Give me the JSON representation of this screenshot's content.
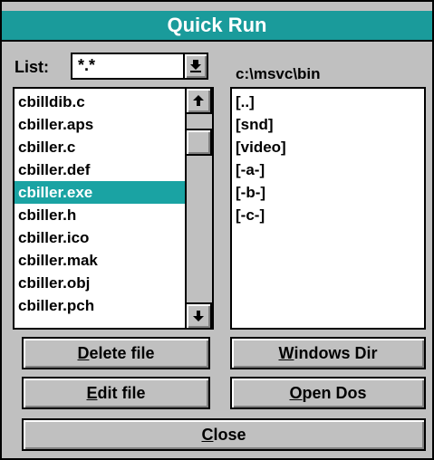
{
  "window": {
    "title": "Quick Run",
    "partial_top_text": "g"
  },
  "list_filter": {
    "label": "List:",
    "value": "*.*"
  },
  "current_dir": "c:\\msvc\\bin",
  "files": [
    "cbilldib.c",
    "cbiller.aps",
    "cbiller.c",
    "cbiller.def",
    "cbiller.exe",
    "cbiller.h",
    "cbiller.ico",
    "cbiller.mak",
    "cbiller.obj",
    "cbiller.pch"
  ],
  "selected_file": "cbiller.exe",
  "dirs": [
    "[..]",
    "[snd]",
    "[video]",
    "[-a-]",
    "[-b-]",
    "[-c-]"
  ],
  "buttons": {
    "delete": {
      "hot": "D",
      "rest": "elete file"
    },
    "windows_dir": {
      "hot": "W",
      "rest": "indows Dir"
    },
    "edit": {
      "hot": "E",
      "rest": "dit file"
    },
    "open_dos": {
      "hot": "O",
      "rest": "pen Dos"
    },
    "close": {
      "hot": "C",
      "rest": "lose"
    }
  },
  "colors": {
    "titlebar": "#1a9b9b",
    "selection": "#1aa3a3",
    "face": "#c0c0c0"
  }
}
